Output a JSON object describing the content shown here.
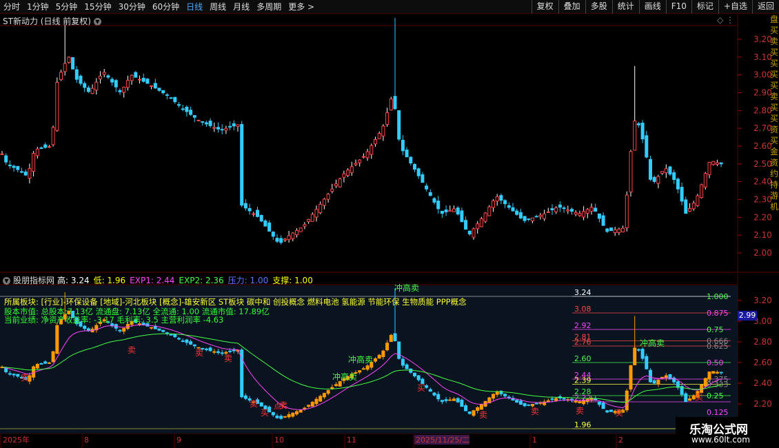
{
  "toolbar": {
    "timeframes": [
      "分时",
      "1分钟",
      "5分钟",
      "15分钟",
      "30分钟",
      "60分钟",
      "日线",
      "周线",
      "月线",
      "多周期",
      "更多 >"
    ],
    "active_timeframe": "日线",
    "tools": [
      "复权",
      "叠加",
      "多股",
      "统计",
      "画线",
      "F10",
      "标记",
      "+自选",
      "返回"
    ]
  },
  "main_chart": {
    "title": "ST新动力 (日线 前复权)",
    "yaxis": [
      "3.20",
      "3.10",
      "3.00",
      "2.90",
      "2.80",
      "2.70",
      "2.60",
      "2.50",
      "2.40",
      "2.30",
      "2.20",
      "2.10",
      "2.00"
    ]
  },
  "indicator": {
    "name": "股朋指标网",
    "params": [
      {
        "label": "高:",
        "value": "3.24",
        "color": "#ffffff"
      },
      {
        "label": "低:",
        "value": "1.96",
        "color": "#ffff00"
      },
      {
        "label": "EXP1:",
        "value": "2.44",
        "color": "#ff44ff"
      },
      {
        "label": "EXP2:",
        "value": "2.36",
        "color": "#44ff44"
      },
      {
        "label": "压力:",
        "value": "1.00",
        "color": "#5a7aff"
      },
      {
        "label": "支撑:",
        "value": "1.00",
        "color": "#ffff00"
      }
    ],
    "info": {
      "line1": "所属板块: [行业]-环保设备 [地域]-河北板块 [概念]-雄安新区 ST板块 碳中和 创投概念 燃料电池 氢能源 节能环保 生物质能 PPP概念",
      "line2": "股本市值: 总股本:7.13亿 流通盘: 7.13亿 全流通: 1.00 流通市值: 17.89亿",
      "line3": "当前业绩: 净资产收益率: -3.17 毛利率: 3.5 主营利润率 -4.63"
    },
    "yaxis": [
      "3.20",
      "3.00",
      "2.80",
      "2.60",
      "2.40",
      "2.20"
    ],
    "current_price": "2.99",
    "levels": [
      "3.24",
      "3.08",
      "2.92",
      "2.81",
      "2.76",
      "2.60",
      "2.44",
      "2.39",
      "2.28",
      "2.22",
      "1.96"
    ],
    "fib": [
      "1.000",
      "0.875",
      "0.75",
      "0.666",
      "0.625",
      "0.50",
      "0.375",
      "0.333",
      "0.25",
      "0.125"
    ],
    "signals": {
      "sell": "卖",
      "buy": "买",
      "rush": "冲高卖",
      "bottom": "点K"
    }
  },
  "xaxis": [
    "2025年",
    "8",
    "9",
    "10",
    "11",
    "2025/11/25/二",
    "1",
    "2"
  ],
  "side_text": [
    "盘",
    "买",
    "卖",
    "买",
    "买",
    "买",
    "买",
    "卖",
    "买",
    "买",
    "资",
    "买",
    "金",
    "资",
    "约",
    "持",
    "游",
    "机"
  ],
  "watermark": {
    "line1": "乐淘公式网",
    "line2": "www.60lt.com"
  },
  "colors": {
    "up": "#ff9900",
    "down": "#33ccff",
    "exp1": "#ff44ff",
    "exp2": "#44ff44",
    "grid": "#5a0000"
  }
}
